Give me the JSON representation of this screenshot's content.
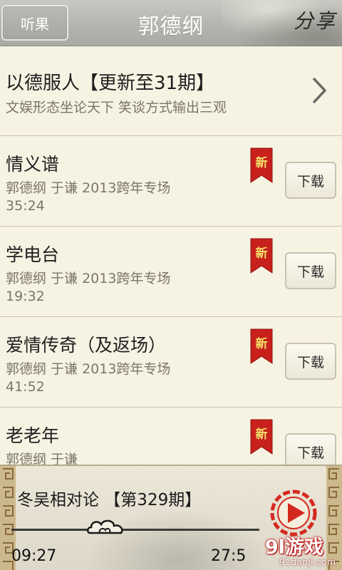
{
  "header": {
    "back_label": "听果",
    "title": "郭德纲",
    "share_label": "分享"
  },
  "album": {
    "name": "以德服人【更新至31期】",
    "description": "文娱形态坐论天下 笑谈方式输出三观"
  },
  "episodes": [
    {
      "name": "情义谱",
      "subtitle": "郭德纲 于谦 2013跨年专场",
      "duration": "35:24",
      "badge": "新",
      "download_label": "下载"
    },
    {
      "name": "学电台",
      "subtitle": "郭德纲 于谦 2013跨年专场",
      "duration": "19:32",
      "badge": "新",
      "download_label": "下载"
    },
    {
      "name": "爱情传奇（及返场）",
      "subtitle": "郭德纲 于谦 2013跨年专场",
      "duration": "41:52",
      "badge": "新",
      "download_label": "下载"
    },
    {
      "name": "老老年",
      "subtitle": "郭德纲 于谦",
      "duration": "",
      "badge": "新",
      "download_label": "下载"
    }
  ],
  "player": {
    "now_playing": "冬吴相对论 【第329期】",
    "current_time": "09:27",
    "total_time": "27:5",
    "progress": 0.38
  },
  "watermark": {
    "logo": "9l游戏",
    "url": "91danji.com"
  },
  "colors": {
    "badge_red": "#c8201c",
    "play_red": "#d4291f",
    "background": "#f7f3e3"
  }
}
